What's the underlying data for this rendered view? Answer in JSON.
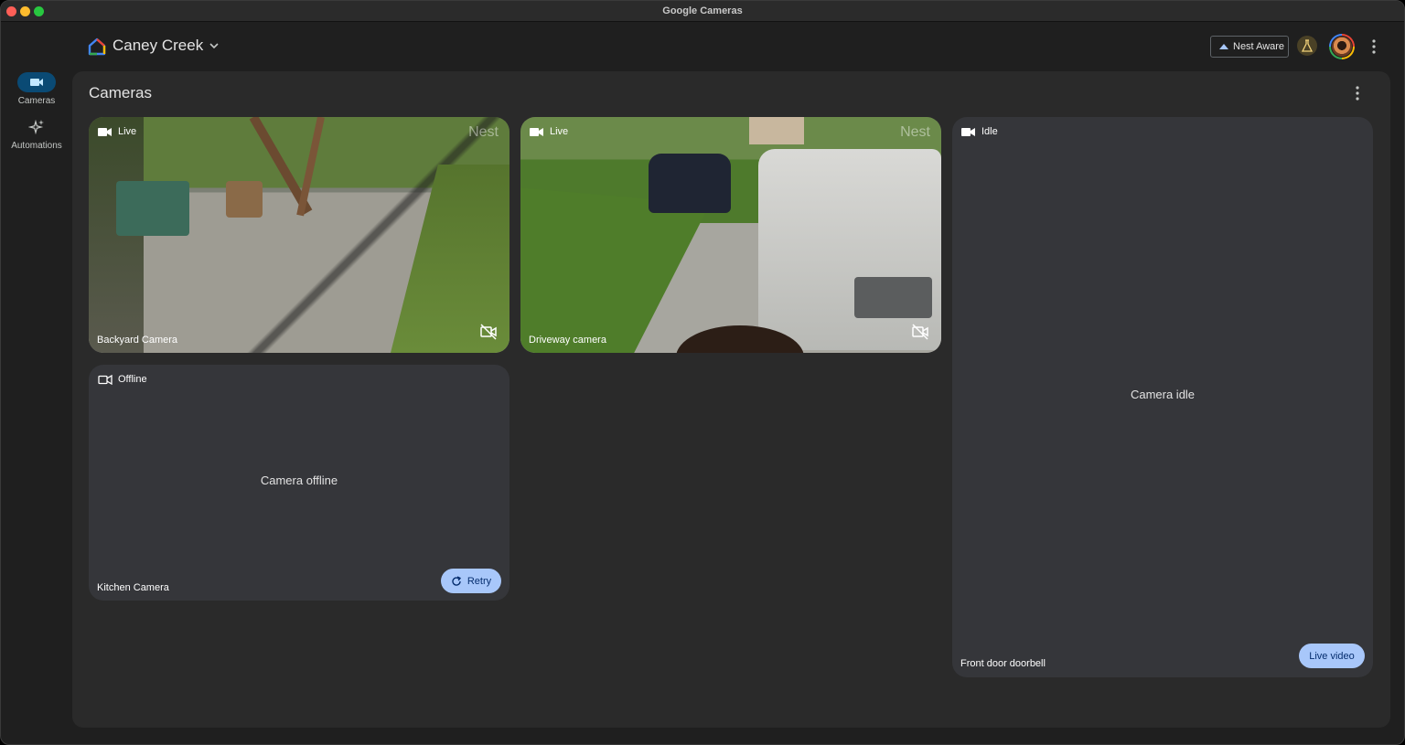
{
  "window": {
    "title": "Google Cameras"
  },
  "header": {
    "home_name": "Caney Creek",
    "nest_aware_label": "Nest Aware"
  },
  "rail": {
    "items": [
      {
        "label": "Cameras",
        "icon": "videocam-icon",
        "active": true
      },
      {
        "label": "Automations",
        "icon": "sparkle-icon",
        "active": false
      }
    ]
  },
  "main": {
    "title": "Cameras",
    "cards": [
      {
        "name": "Backyard Camera",
        "status": "Live",
        "watermark": "Nest"
      },
      {
        "name": "Driveway camera",
        "status": "Live",
        "watermark": "Nest"
      },
      {
        "name": "Front door doorbell",
        "status": "Idle",
        "message": "Camera idle",
        "button_label": "Live video"
      },
      {
        "name": "Kitchen Camera",
        "status": "Offline",
        "message": "Camera offline",
        "button_label": "Retry"
      }
    ]
  },
  "colors": {
    "window_bg": "#1f1f1f",
    "panel_bg": "#2a2a2a",
    "card_bg": "#35363a",
    "accent_button": "#a8c7fa",
    "rail_active": "#0a4a74"
  }
}
